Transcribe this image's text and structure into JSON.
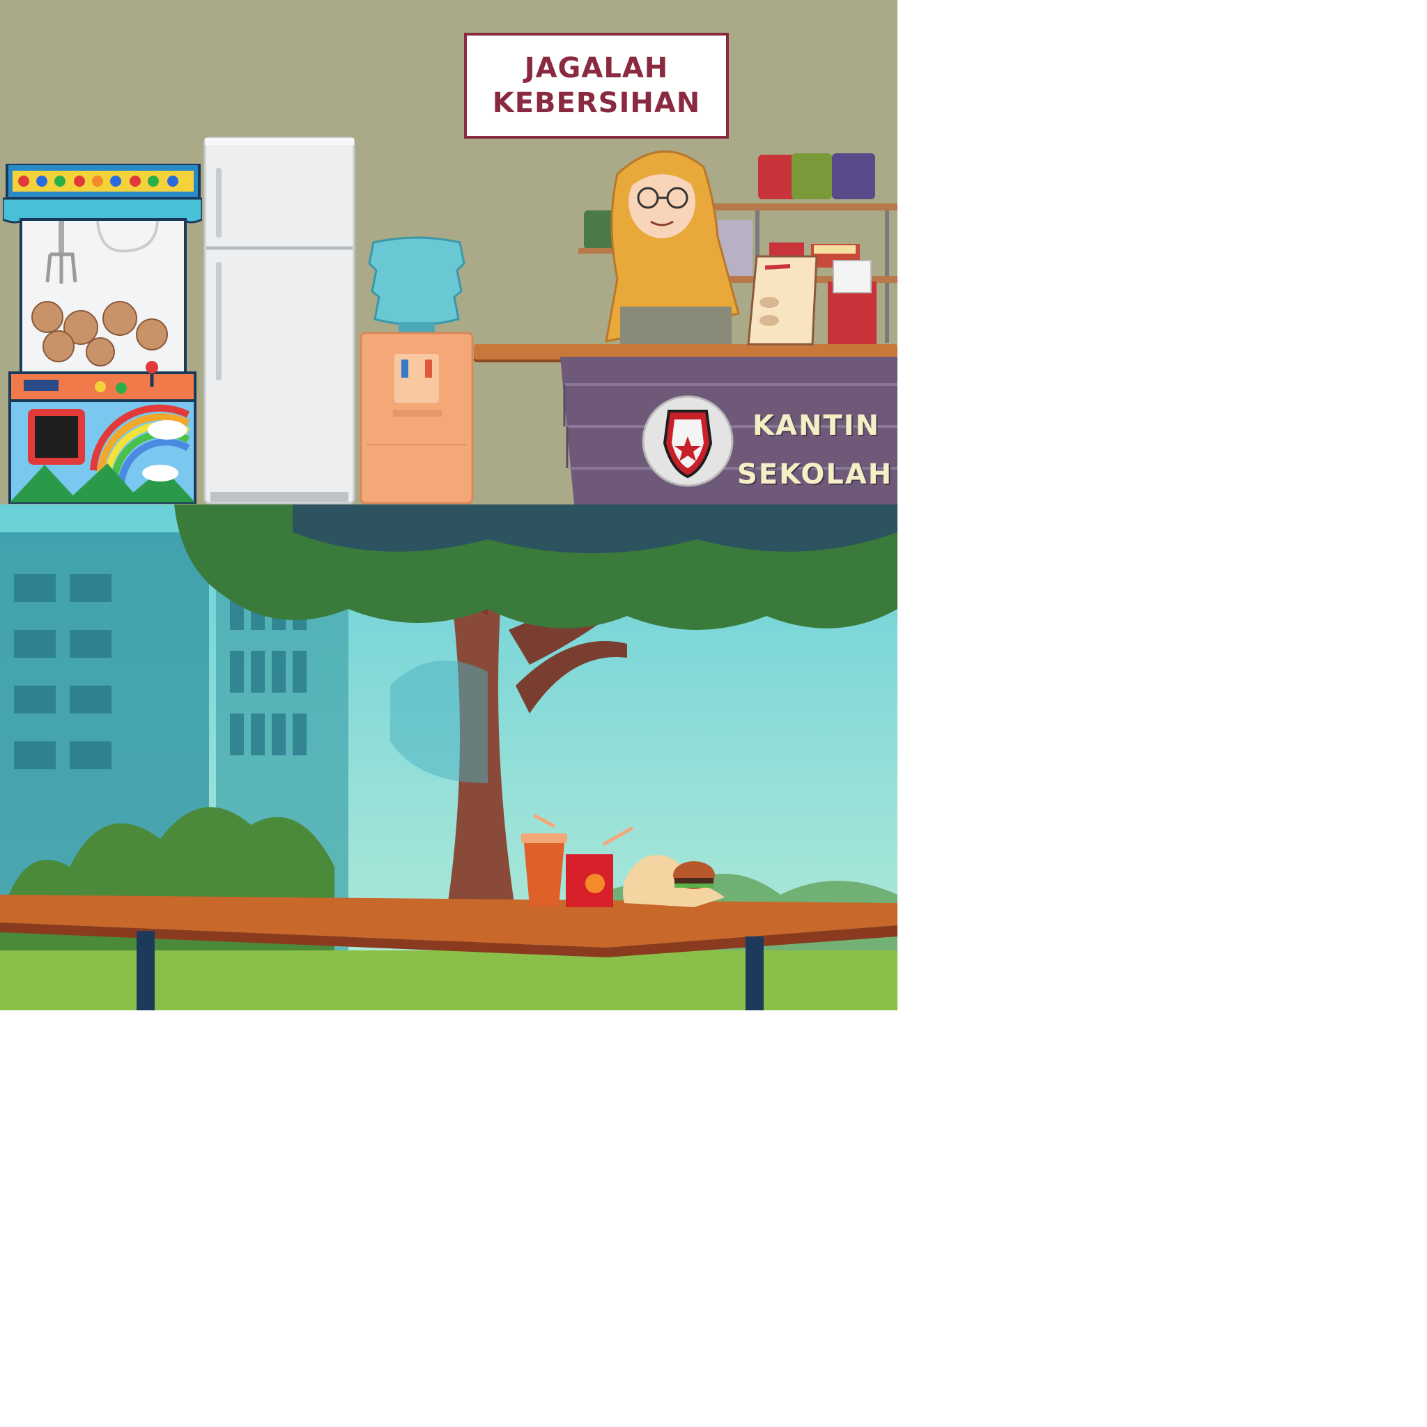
{
  "canteen": {
    "sign": {
      "line1": "JAGALAH",
      "line2": "KEBERSIHAN"
    },
    "counter": {
      "line1": "KANTIN",
      "line2": "SEKOLAH"
    },
    "objects": [
      "claw-machine",
      "refrigerator",
      "water-dispenser",
      "canteen-keeper",
      "shelf",
      "menu-card",
      "school-emblem"
    ]
  },
  "park": {
    "objects": [
      "tree",
      "buildings",
      "bushes",
      "table",
      "drink-cup",
      "juice-box",
      "burger"
    ]
  },
  "colors": {
    "wall": "#aaaa88",
    "sign_text": "#8a2a40",
    "counter": "#6e5a78",
    "counter_text": "#f6efc6",
    "sky": "#9fe0dc",
    "grass": "#8ac04a"
  }
}
